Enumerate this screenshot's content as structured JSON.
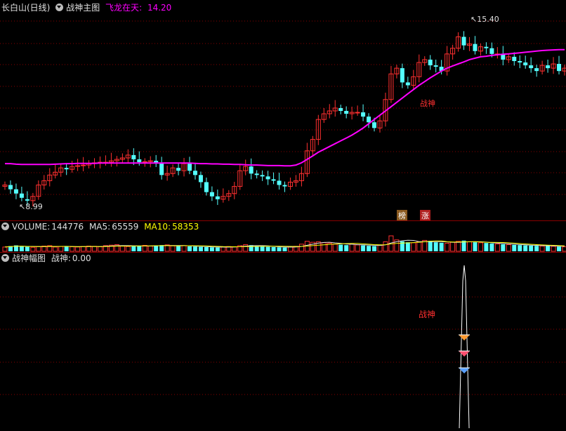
{
  "main_panel": {
    "title": "长白山(日线)",
    "indicator_name": "战神主图",
    "line_label": "飞龙在天",
    "line_value": "14.20",
    "high_marker": "15.40",
    "low_marker": "8.99",
    "signal_text": "战神",
    "badge_1": "榜",
    "badge_2": "涨",
    "colors": {
      "up": "#ff3030",
      "down": "#54ffff",
      "ma_line": "#ff00ff",
      "grid": "#8a0000"
    }
  },
  "volume_panel": {
    "label": "VOLUME:",
    "volume": "144776",
    "ma5_label": "MA5:",
    "ma5": "65559",
    "ma10_label": "MA10:",
    "ma10": "58353"
  },
  "sub_panel": {
    "name": "战神幅图",
    "value_label": "战神:",
    "value": "0.00",
    "signal_text": "战神"
  },
  "chart_data": {
    "type": "candlestick",
    "x": [
      "1",
      "2",
      "3",
      "4",
      "5",
      "6",
      "7",
      "8",
      "9",
      "10",
      "11",
      "12",
      "13",
      "14",
      "15",
      "16",
      "17",
      "18",
      "19",
      "20",
      "21",
      "22",
      "23",
      "24",
      "25",
      "26",
      "27",
      "28",
      "29",
      "30",
      "31",
      "32",
      "33",
      "34",
      "35",
      "36",
      "37",
      "38",
      "39",
      "40",
      "41",
      "42",
      "43",
      "44",
      "45",
      "46",
      "47",
      "48",
      "49",
      "50",
      "51",
      "52",
      "53",
      "54",
      "55",
      "56",
      "57",
      "58",
      "59",
      "60",
      "61",
      "62",
      "63",
      "64",
      "65",
      "66",
      "67",
      "68",
      "69",
      "70",
      "71",
      "72",
      "73",
      "74",
      "75",
      "76",
      "77",
      "78",
      "79",
      "80",
      "81",
      "82",
      "83",
      "84",
      "85",
      "86",
      "87",
      "88",
      "89",
      "90",
      "91",
      "92",
      "93",
      "94",
      "95",
      "96",
      "97",
      "98",
      "99",
      "100",
      "101"
    ],
    "open": [
      9.55,
      9.6,
      9.45,
      9.3,
      9.1,
      9.05,
      9.2,
      9.6,
      9.75,
      9.95,
      10.05,
      10.2,
      10.15,
      10.25,
      10.28,
      10.3,
      10.35,
      10.38,
      10.4,
      10.4,
      10.45,
      10.5,
      10.55,
      10.65,
      10.5,
      10.4,
      10.42,
      10.45,
      10.35,
      9.95,
      10.0,
      10.2,
      10.1,
      10.35,
      10.1,
      9.95,
      9.7,
      9.35,
      9.2,
      9.1,
      9.2,
      9.3,
      9.55,
      10.1,
      10.25,
      10.0,
      9.95,
      9.9,
      9.8,
      9.75,
      9.6,
      9.55,
      9.7,
      9.75,
      10.0,
      10.8,
      11.2,
      11.9,
      12.1,
      12.2,
      12.3,
      12.2,
      12.1,
      12.15,
      12.15,
      12.0,
      11.8,
      11.6,
      11.85,
      12.6,
      13.5,
      13.7,
      13.2,
      13.1,
      13.4,
      13.9,
      14.0,
      13.8,
      13.75,
      13.6,
      14.2,
      14.4,
      14.8,
      14.5,
      14.55,
      14.3,
      14.45,
      14.4,
      14.2,
      14.2,
      14.0,
      14.1,
      13.95,
      13.9,
      13.8,
      13.7,
      13.6,
      13.8,
      13.7,
      13.85,
      13.6
    ],
    "close": [
      9.6,
      9.45,
      9.3,
      9.15,
      9.05,
      9.2,
      9.6,
      9.75,
      9.95,
      10.05,
      10.2,
      10.15,
      10.25,
      10.28,
      10.3,
      10.35,
      10.38,
      10.4,
      10.4,
      10.45,
      10.5,
      10.55,
      10.65,
      10.5,
      10.4,
      10.42,
      10.45,
      10.35,
      9.95,
      10.0,
      10.2,
      10.1,
      10.35,
      10.1,
      9.95,
      9.7,
      9.35,
      9.2,
      9.1,
      9.2,
      9.3,
      9.55,
      10.1,
      10.25,
      10.0,
      9.95,
      9.9,
      9.8,
      9.75,
      9.6,
      9.55,
      9.7,
      9.75,
      10.0,
      10.8,
      11.2,
      11.9,
      12.1,
      12.2,
      12.3,
      12.2,
      12.1,
      12.15,
      12.15,
      12.0,
      11.8,
      11.6,
      11.85,
      12.6,
      13.5,
      13.7,
      13.2,
      13.1,
      13.4,
      13.9,
      14.0,
      13.8,
      13.75,
      13.6,
      14.2,
      14.4,
      14.8,
      14.5,
      14.55,
      14.3,
      14.45,
      14.4,
      14.2,
      14.2,
      14.0,
      14.1,
      13.95,
      13.9,
      13.8,
      13.7,
      13.6,
      13.8,
      13.7,
      13.85,
      13.6,
      13.7
    ],
    "ma_line": [
      10.35,
      10.35,
      10.33,
      10.32,
      10.32,
      10.32,
      10.32,
      10.32,
      10.32,
      10.33,
      10.34,
      10.35,
      10.35,
      10.36,
      10.36,
      10.36,
      10.36,
      10.37,
      10.37,
      10.37,
      10.37,
      10.37,
      10.37,
      10.37,
      10.37,
      10.37,
      10.37,
      10.37,
      10.37,
      10.37,
      10.37,
      10.37,
      10.37,
      10.37,
      10.36,
      10.35,
      10.35,
      10.34,
      10.34,
      10.33,
      10.33,
      10.32,
      10.32,
      10.31,
      10.3,
      10.3,
      10.29,
      10.28,
      10.28,
      10.28,
      10.27,
      10.27,
      10.3,
      10.38,
      10.5,
      10.62,
      10.75,
      10.85,
      10.95,
      11.05,
      11.15,
      11.25,
      11.35,
      11.47,
      11.6,
      11.75,
      11.9,
      12.05,
      12.2,
      12.35,
      12.5,
      12.65,
      12.8,
      12.95,
      13.1,
      13.23,
      13.36,
      13.48,
      13.6,
      13.7,
      13.78,
      13.85,
      13.92,
      14.0,
      14.05,
      14.1,
      14.12,
      14.15,
      14.17,
      14.19,
      14.2,
      14.22,
      14.24,
      14.26,
      14.28,
      14.3,
      14.32,
      14.33,
      14.34,
      14.35,
      14.35
    ],
    "volume": [
      18,
      22,
      25,
      20,
      19,
      17,
      20,
      22,
      24,
      18,
      20,
      21,
      19,
      18,
      20,
      22,
      21,
      19,
      24,
      26,
      28,
      22,
      20,
      21,
      23,
      25,
      22,
      24,
      26,
      27,
      23,
      22,
      24,
      21,
      20,
      19,
      18,
      17,
      16,
      18,
      20,
      19,
      24,
      28,
      26,
      22,
      20,
      19,
      18,
      17,
      16,
      18,
      21,
      30,
      42,
      38,
      40,
      36,
      34,
      30,
      28,
      26,
      30,
      27,
      25,
      23,
      22,
      26,
      40,
      65,
      48,
      42,
      38,
      36,
      40,
      46,
      44,
      38,
      36,
      34,
      38,
      42,
      45,
      40,
      38,
      36,
      35,
      33,
      31,
      30,
      28,
      27,
      26,
      25,
      24,
      23,
      22,
      24,
      21,
      20,
      19
    ],
    "sub_signal": {
      "peak_index": 82,
      "value": 0.0
    }
  }
}
